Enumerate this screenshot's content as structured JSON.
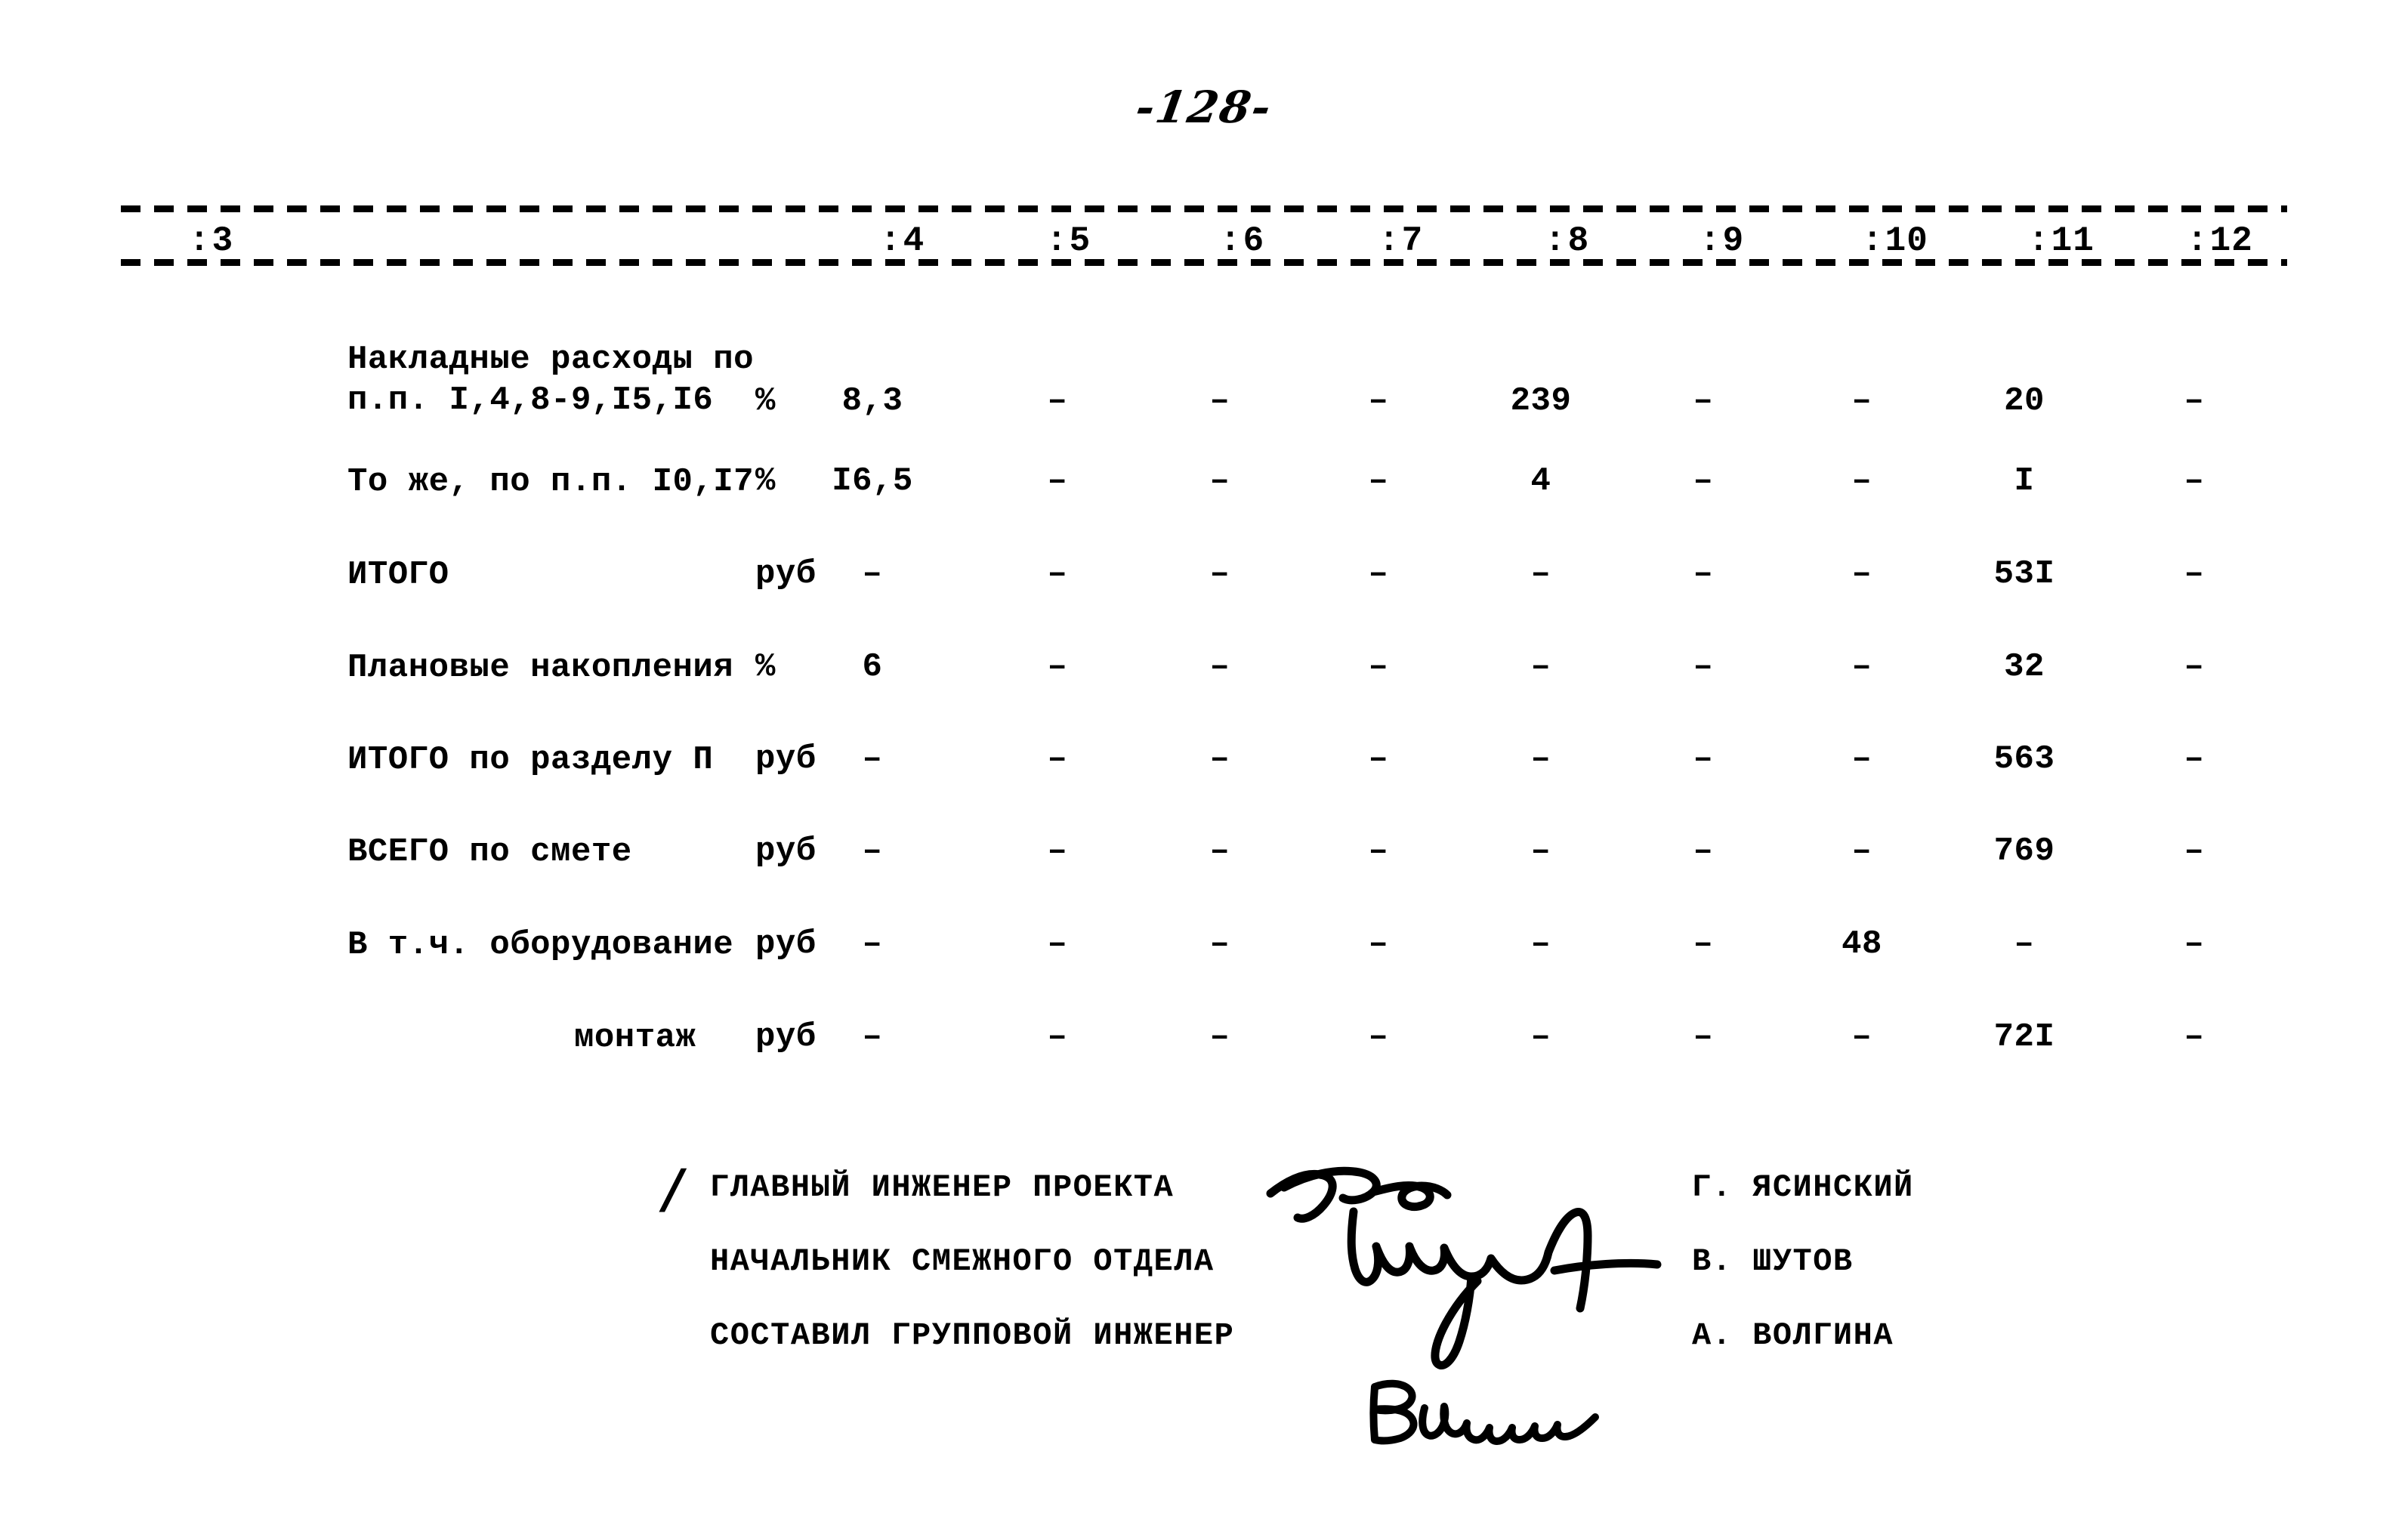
{
  "document": {
    "folio": "-128-",
    "kind": "construction-cost-estimate-continuation"
  },
  "table": {
    "column_headers": [
      {
        "sep": ":",
        "num": "3"
      },
      {
        "sep": ":",
        "num": "4"
      },
      {
        "sep": ":",
        "num": "5"
      },
      {
        "sep": ":",
        "num": "6"
      },
      {
        "sep": ":",
        "num": "7"
      },
      {
        "sep": ":",
        "num": "8"
      },
      {
        "sep": ":",
        "num": "9"
      },
      {
        "sep": ":",
        "num": "10"
      },
      {
        "sep": ":",
        "num": "11"
      },
      {
        "sep": ":",
        "num": "12"
      },
      {
        "sep": "",
        "num": ""
      }
    ],
    "rows": [
      {
        "label": "Накладные расходы по\nп.п. I,4,8-9,I5,I6",
        "unit": "%",
        "values": [
          "8,3",
          "–",
          "–",
          "–",
          "239",
          "–",
          "–",
          "20",
          "–"
        ]
      },
      {
        "label": "То же, по п.п. I0,I7",
        "unit": "%",
        "values": [
          "I6,5",
          "–",
          "–",
          "–",
          "4",
          "–",
          "–",
          "I",
          "–"
        ]
      },
      {
        "label": "ИТОГО",
        "unit": "руб",
        "values": [
          "–",
          "–",
          "–",
          "–",
          "–",
          "–",
          "–",
          "53I",
          "–"
        ]
      },
      {
        "label": "Плановые накопления",
        "unit": "%",
        "values": [
          "6",
          "–",
          "–",
          "–",
          "–",
          "–",
          "–",
          "32",
          "–"
        ]
      },
      {
        "label": "ИТОГО по разделу П",
        "unit": "руб",
        "values": [
          "–",
          "–",
          "–",
          "–",
          "–",
          "–",
          "–",
          "563",
          "–"
        ]
      },
      {
        "label": "ВСЕГО по смете",
        "unit": "руб",
        "values": [
          "–",
          "–",
          "–",
          "–",
          "–",
          "–",
          "–",
          "769",
          "–"
        ]
      },
      {
        "label": "В т.ч. оборудование",
        "unit": "руб",
        "values": [
          "–",
          "–",
          "–",
          "–",
          "–",
          "–",
          "48",
          "–",
          "–"
        ]
      },
      {
        "label": "монтаж",
        "indent": true,
        "unit": "руб",
        "values": [
          "–",
          "–",
          "–",
          "–",
          "–",
          "–",
          "–",
          "72I",
          "–"
        ]
      }
    ]
  },
  "signatures": {
    "leading_mark": "/",
    "rows": [
      {
        "role": "ГЛАВНЫЙ ИНЖЕНЕР ПРОЕКТА",
        "name": "Г. ЯСИНСКИЙ"
      },
      {
        "role": "НАЧАЛЬНИК СМЕЖНОГО ОТДЕЛА",
        "name": "В. ШУТОВ"
      },
      {
        "role": "СОСТАВИЛ ГРУППОВОЙ ИНЖЕНЕР",
        "name": "А. ВОЛГИНА"
      }
    ]
  }
}
